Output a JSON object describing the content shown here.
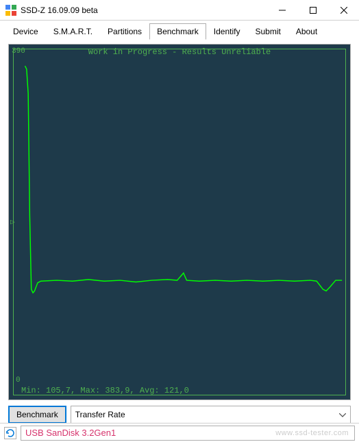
{
  "window": {
    "title": "SSD-Z 16.09.09 beta"
  },
  "tabs": {
    "device": "Device",
    "smart": "S.M.A.R.T.",
    "partitions": "Partitions",
    "benchmark": "Benchmark",
    "identify": "Identify",
    "submit": "Submit",
    "about": "About"
  },
  "chart": {
    "title": "Work in Progress - Results Unreliable",
    "y_max": "390",
    "y_min": "0",
    "y_marker": "▷",
    "stats": "Min: 105,7, Max: 383,9, Avg: 121,0"
  },
  "controls": {
    "benchmark_btn": "Benchmark",
    "dropdown_value": "Transfer Rate"
  },
  "status": {
    "device": "USB SanDisk 3.2Gen1",
    "watermark": "www.ssd-tester.com"
  },
  "chart_data": {
    "type": "line",
    "title": "Work in Progress - Results Unreliable",
    "xlabel": "",
    "ylabel": "Transfer Rate",
    "ylim": [
      0,
      390
    ],
    "x_range": [
      0,
      100
    ],
    "stats": {
      "min": 105.7,
      "max": 383.9,
      "avg": 121.0
    },
    "series": [
      {
        "name": "Transfer Rate",
        "points": [
          [
            0,
            383.9
          ],
          [
            0.5,
            380
          ],
          [
            1,
            350
          ],
          [
            1.5,
            200
          ],
          [
            2,
            110
          ],
          [
            2.5,
            105.7
          ],
          [
            3,
            108
          ],
          [
            4,
            118
          ],
          [
            5,
            120
          ],
          [
            10,
            121
          ],
          [
            15,
            120
          ],
          [
            20,
            122
          ],
          [
            25,
            120
          ],
          [
            30,
            121
          ],
          [
            35,
            119
          ],
          [
            40,
            121
          ],
          [
            45,
            122
          ],
          [
            48,
            121
          ],
          [
            50,
            130
          ],
          [
            51,
            121
          ],
          [
            55,
            120
          ],
          [
            60,
            121
          ],
          [
            65,
            120
          ],
          [
            70,
            121
          ],
          [
            75,
            120
          ],
          [
            80,
            121
          ],
          [
            85,
            120
          ],
          [
            90,
            121
          ],
          [
            92,
            120
          ],
          [
            94,
            110
          ],
          [
            95,
            108
          ],
          [
            96,
            112
          ],
          [
            98,
            121
          ],
          [
            100,
            121
          ]
        ]
      }
    ]
  }
}
